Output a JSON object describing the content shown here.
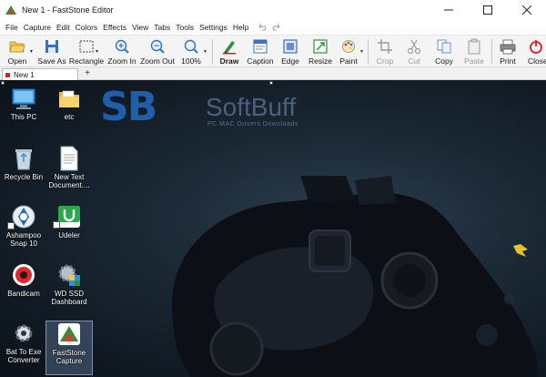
{
  "window": {
    "title": "New 1 - FastStone Editor"
  },
  "menu": [
    "File",
    "Capture",
    "Edit",
    "Colors",
    "Effects",
    "View",
    "Tabs",
    "Tools",
    "Settings",
    "Help"
  ],
  "toolbar": {
    "open": "Open",
    "save_as": "Save As",
    "rectangle": "Rectangle",
    "zoom_in": "Zoom In",
    "zoom_out": "Zoom Out",
    "zoom_level": "100%",
    "draw": "Draw",
    "caption": "Caption",
    "edge": "Edge",
    "resize": "Resize",
    "paint": "Paint",
    "crop": "Crop",
    "cut": "Cut",
    "copy": "Copy",
    "paste": "Paste",
    "print": "Print",
    "close": "Close"
  },
  "tabs": {
    "active": "New 1",
    "new_tab": "+"
  },
  "watermark": {
    "logo": "SB",
    "name": "SoftBuff",
    "tagline": "PC MAC Drivers Downloads"
  },
  "desktop_icons": [
    {
      "label": "This PC",
      "icon": "computer-icon"
    },
    {
      "label": "etc",
      "icon": "folder-icon"
    },
    {
      "label": "Recycle Bin",
      "icon": "recycle-bin-icon"
    },
    {
      "label": "New Text Document....",
      "icon": "text-document-icon"
    },
    {
      "label": "Ashampoo Snap 10",
      "icon": "ashampoo-snap-icon"
    },
    {
      "label": "Udeler",
      "icon": "udeler-icon"
    },
    {
      "label": "Bandicam",
      "icon": "bandicam-icon"
    },
    {
      "label": "WD SSD Dashboard",
      "icon": "wd-dashboard-icon"
    },
    {
      "label": "Bat To Exe Converter",
      "icon": "gear-icon"
    },
    {
      "label": "FastStone Capture",
      "icon": "faststone-icon"
    }
  ],
  "colors": {
    "accent": "#1f5ea8",
    "tab_marker": "#d42020"
  }
}
